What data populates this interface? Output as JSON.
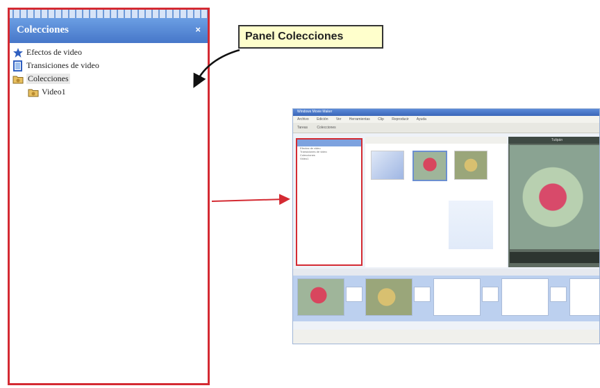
{
  "panel": {
    "title": "Colecciones",
    "close_glyph": "×",
    "items": [
      {
        "label": "Efectos de video",
        "icon": "star-icon"
      },
      {
        "label": "Transiciones de video",
        "icon": "document-icon"
      },
      {
        "label": "Colecciones",
        "icon": "folder-icon",
        "selected": true
      },
      {
        "label": "Video1",
        "icon": "folder-icon",
        "child": true
      }
    ]
  },
  "callout": {
    "text": "Panel Colecciones"
  },
  "colors": {
    "highlight_red": "#d42a32",
    "header_blue": "#4777c9",
    "callout_yellow": "#ffffcc"
  },
  "app_window": {
    "title": "Windows Movie Maker",
    "menu": [
      "Archivo",
      "Edición",
      "Ver",
      "Herramientas",
      "Clip",
      "Reproducir",
      "Ayuda"
    ],
    "toolbar": [
      "Tareas",
      "Colecciones"
    ],
    "monitor_title": "Tulipán"
  }
}
